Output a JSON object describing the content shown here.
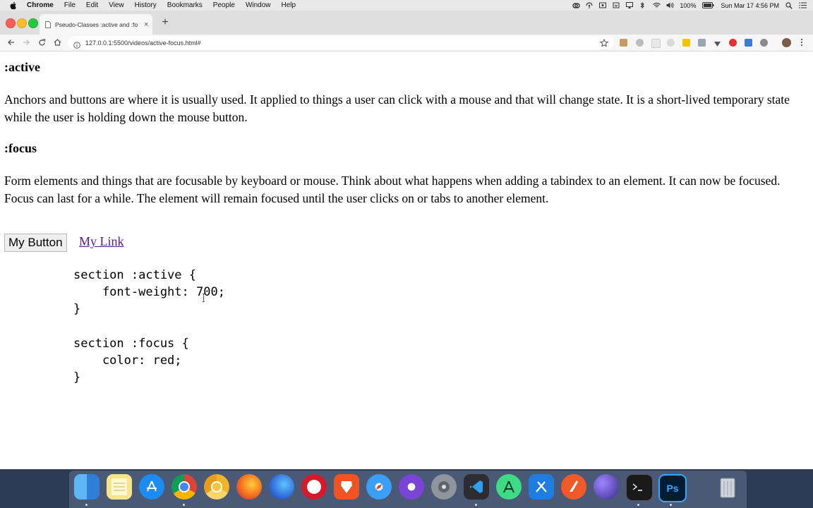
{
  "menubar": {
    "app_name": "Chrome",
    "menus": [
      "File",
      "Edit",
      "View",
      "History",
      "Bookmarks",
      "People",
      "Window",
      "Help"
    ],
    "battery": "100%",
    "clock": "Sun Mar 17  4:56 PM"
  },
  "browser": {
    "tab_title": "Pseudo-Classes :active and :fo",
    "tab_close": "×",
    "new_tab": "+",
    "url": "127.0.0.1:5500/videos/active-focus.html#"
  },
  "page": {
    "heading_active": ":active",
    "text_active": "Anchors and buttons are where it is usually used. It applied to things a user can click with a mouse and that will change state. It is a short-lived temporary state while the user is holding down the mouse button.",
    "heading_focus": ":focus",
    "text_focus": "Form elements and things that are focusable by keyboard or mouse. Think about what happens when adding a tabindex to an element. It can now be focused. Focus can last for a while. The element will remain focused until the user clicks on or tabs to another element.",
    "button_label": "My Button",
    "link_label": "My Link",
    "code": "section :active {\n    font-weight: 700;\n}\n\nsection :focus {\n    color: red;\n}"
  },
  "dock": {
    "apps": [
      "Finder",
      "Notes",
      "App Store",
      "Chrome",
      "Chrome Canary",
      "Firefox",
      "Firefox Developer Edition",
      "Opera",
      "Brave",
      "Safari",
      "Safari Technology Preview",
      "Automator",
      "Visual Studio Code",
      "Android Studio",
      "Xcode",
      "Affinity Designer",
      "Affinity Photo",
      "Terminal",
      "Photoshop",
      "Trash"
    ],
    "photoshop_label": "Ps"
  }
}
